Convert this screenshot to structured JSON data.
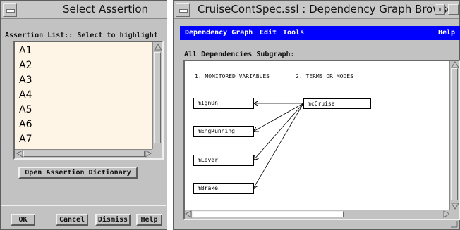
{
  "assertion_window": {
    "title": "Select Assertion",
    "list_caption": "Assertion List:: Select to highlight",
    "items": [
      "A1",
      "A2",
      "A3",
      "A4",
      "A5",
      "A6",
      "A7"
    ],
    "open_dictionary_label": "Open Assertion Dictionary",
    "buttons": {
      "ok": "OK",
      "cancel": "Cancel",
      "dismiss": "Dismiss",
      "help": "Help"
    },
    "list_background": "#fff5e6"
  },
  "graph_window": {
    "title": "CruiseContSpec.ssl : Dependency Graph Browser",
    "menu": {
      "dependency_graph": "Dependency Graph",
      "edit": "Edit",
      "tools": "Tools",
      "help": "Help"
    },
    "menubar_color": "#0000ff",
    "subgraph_caption": "All Dependencies Subgraph:",
    "column_headers": {
      "monitored": "1. MONITORED VARIABLES",
      "terms": "2. TERMS OR MODES"
    },
    "monitored_variables": [
      "mIgnOn",
      "mEngRunning",
      "mLever",
      "mBrake"
    ],
    "terms_or_modes": [
      "mcCruise"
    ],
    "dependencies": [
      {
        "from": "mcCruise",
        "to": "mIgnOn"
      },
      {
        "from": "mcCruise",
        "to": "mEngRunning"
      },
      {
        "from": "mcCruise",
        "to": "mLever"
      },
      {
        "from": "mcCruise",
        "to": "mBrake"
      }
    ]
  }
}
